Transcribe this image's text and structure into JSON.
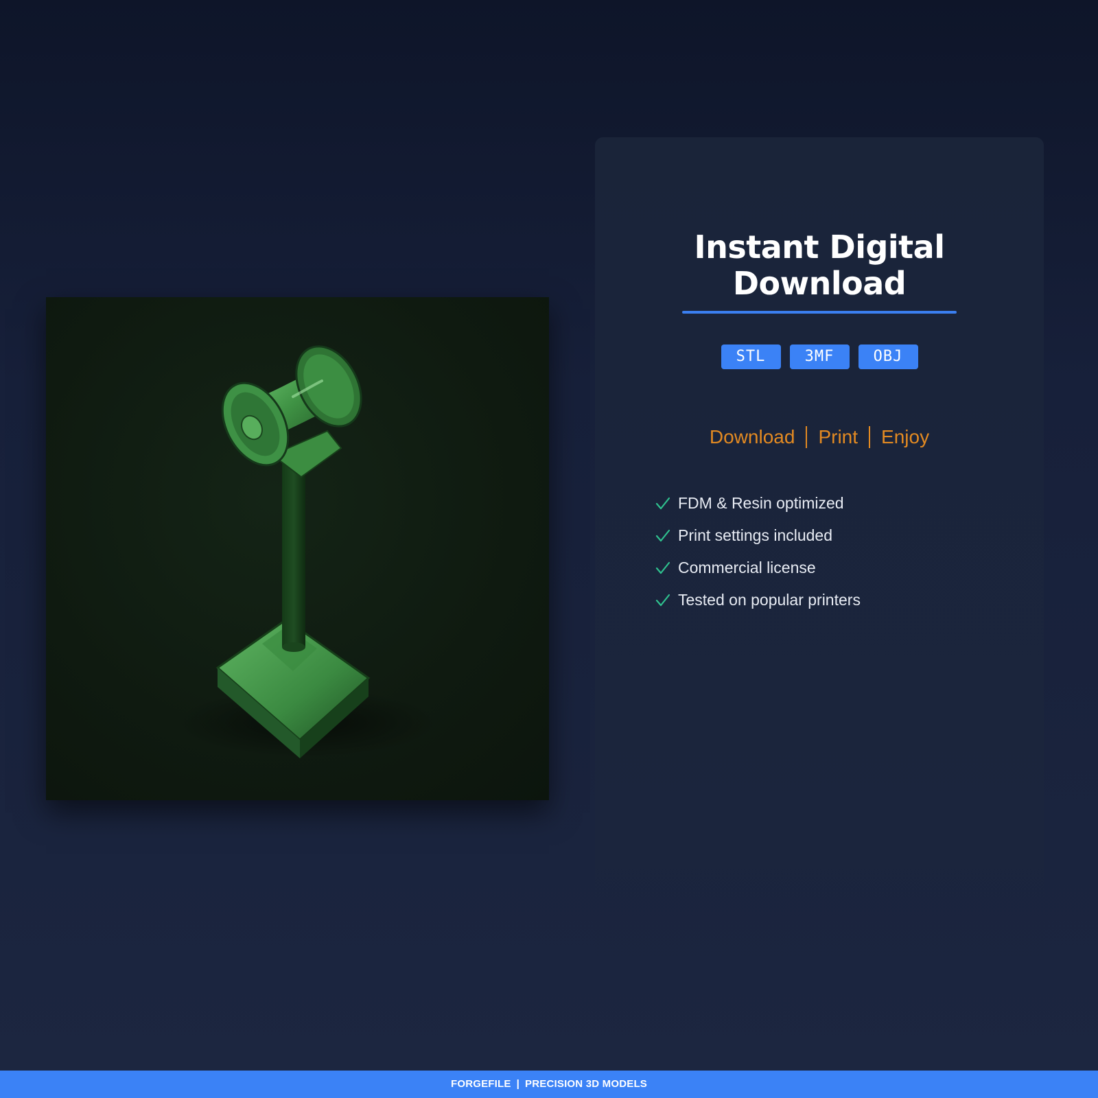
{
  "product_image": {
    "alt": "3D printed spool holder model",
    "model_color": "#3f8f45",
    "background_color": "#101c11"
  },
  "card": {
    "title_line1": "Instant Digital",
    "title_line2": "Download",
    "accent_color": "#3b7ff0",
    "formats": [
      "STL",
      "3MF",
      "OBJ"
    ],
    "tagline": {
      "parts": [
        "Download",
        "Print",
        "Enjoy"
      ],
      "color": "#e38a22"
    },
    "features": [
      "FDM & Resin optimized",
      "Print settings included",
      "Commercial license",
      "Tested on popular printers"
    ],
    "check_color": "#2fc28f"
  },
  "footer": {
    "brand": "FORGEFILE",
    "separator": "|",
    "slogan": "PRECISION 3D MODELS",
    "color": "#3b82f6"
  }
}
